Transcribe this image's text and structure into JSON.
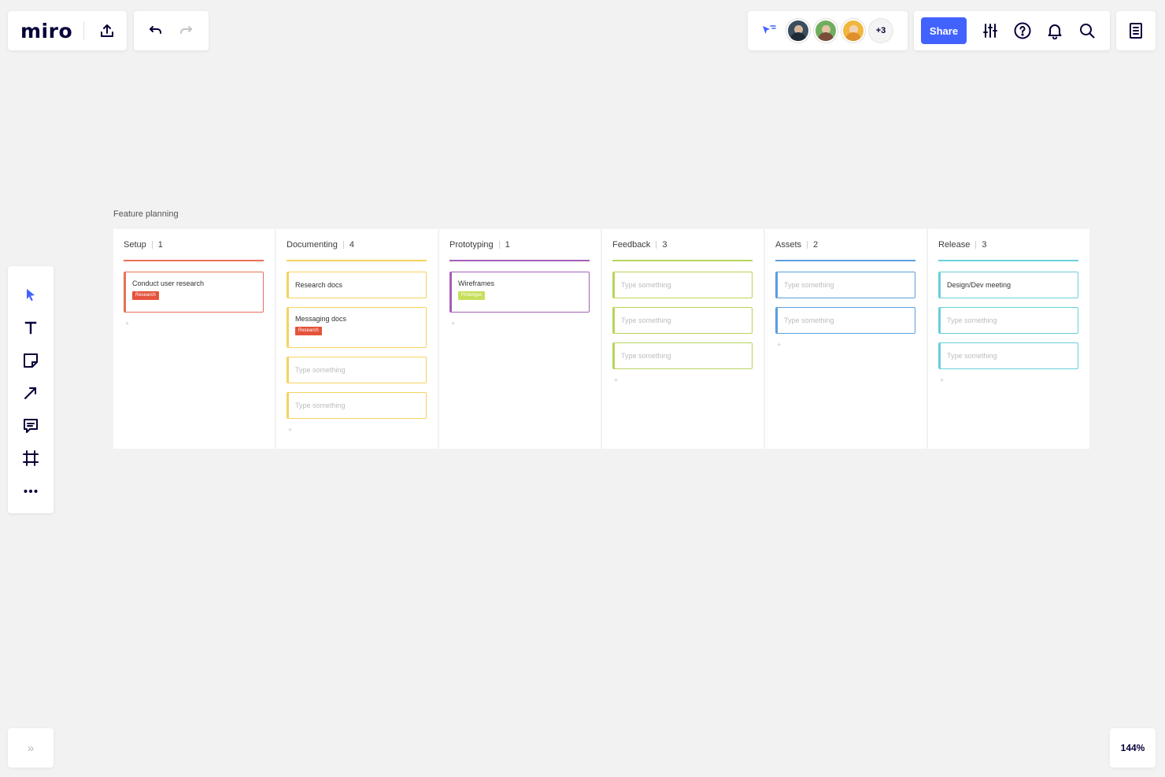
{
  "app": {
    "logo": "miro"
  },
  "collaborators": {
    "more": "+3"
  },
  "header": {
    "share_label": "Share"
  },
  "zoom": {
    "level": "144%"
  },
  "sidebar": {
    "expand": "»"
  },
  "frame": {
    "title": "Feature planning"
  },
  "colors": {
    "accent": "#4262ff",
    "setup": "#e8705a",
    "documenting": "#f6d25c",
    "prototyping": "#a55fb6",
    "feedback": "#b7d55a",
    "assets": "#5b9fde",
    "release": "#69d0dc",
    "tag_research": "#e5533d",
    "tag_prototype": "#c6df5a"
  },
  "columns": [
    {
      "title": "Setup",
      "count": "1",
      "cards": [
        {
          "text": "Conduct user research",
          "tag": "Research",
          "placeholder": false
        }
      ],
      "add": "+"
    },
    {
      "title": "Documenting",
      "count": "4",
      "cards": [
        {
          "text": "Research docs",
          "tag": "",
          "placeholder": false
        },
        {
          "text": "Messaging docs",
          "tag": "Research",
          "placeholder": false
        },
        {
          "text": "Type something",
          "tag": "",
          "placeholder": true
        },
        {
          "text": "Type something",
          "tag": "",
          "placeholder": true
        }
      ],
      "add": "+"
    },
    {
      "title": "Prototyping",
      "count": "1",
      "cards": [
        {
          "text": "Wireframes",
          "tag": "Prototype",
          "placeholder": false
        }
      ],
      "add": "+"
    },
    {
      "title": "Feedback",
      "count": "3",
      "cards": [
        {
          "text": "Type something",
          "tag": "",
          "placeholder": true
        },
        {
          "text": "Type something",
          "tag": "",
          "placeholder": true
        },
        {
          "text": "Type something",
          "tag": "",
          "placeholder": true
        }
      ],
      "add": "+"
    },
    {
      "title": "Assets",
      "count": "2",
      "cards": [
        {
          "text": "Type something",
          "tag": "",
          "placeholder": true
        },
        {
          "text": "Type something",
          "tag": "",
          "placeholder": true
        }
      ],
      "add": "+"
    },
    {
      "title": "Release",
      "count": "3",
      "cards": [
        {
          "text": "Design/Dev meeting",
          "tag": "",
          "placeholder": false
        },
        {
          "text": "Type something",
          "tag": "",
          "placeholder": true
        },
        {
          "text": "Type something",
          "tag": "",
          "placeholder": true
        }
      ],
      "add": "+"
    }
  ]
}
